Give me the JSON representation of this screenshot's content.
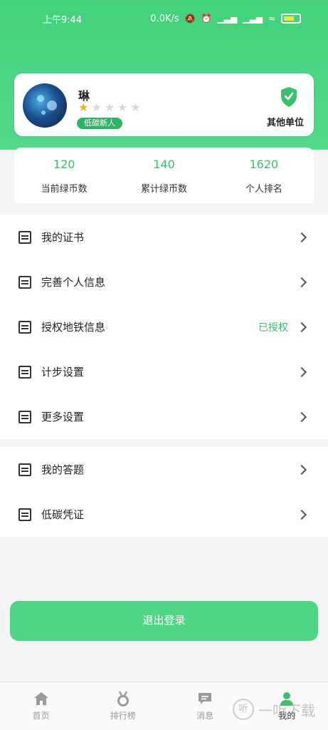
{
  "status_bar": {
    "time": "上午9:44",
    "net_speed": "0.0K/s",
    "icons": [
      "mute-icon",
      "alarm-icon",
      "signal-icon",
      "signal-icon",
      "wifi-icon",
      "battery-icon"
    ]
  },
  "profile": {
    "name": "琳",
    "rating": 1,
    "rating_max": 5,
    "badge": "低碳新人",
    "org_label": "其他单位"
  },
  "stats": [
    {
      "value": "120",
      "label": "当前绿币数"
    },
    {
      "value": "140",
      "label": "累计绿币数"
    },
    {
      "value": "1620",
      "label": "个人排名"
    }
  ],
  "menu_group1": [
    {
      "label": "我的证书",
      "status": ""
    },
    {
      "label": "完善个人信息",
      "status": ""
    },
    {
      "label": "授权地铁信息",
      "status": "已授权"
    },
    {
      "label": "计步设置",
      "status": ""
    },
    {
      "label": "更多设置",
      "status": ""
    }
  ],
  "menu_group2": [
    {
      "label": "我的答题",
      "status": ""
    },
    {
      "label": "低碳凭证",
      "status": ""
    }
  ],
  "logout_label": "退出登录",
  "tabs": [
    {
      "label": "首页",
      "icon": "home-icon"
    },
    {
      "label": "排行榜",
      "icon": "medal-icon"
    },
    {
      "label": "消息",
      "icon": "message-icon"
    },
    {
      "label": "我的",
      "icon": "user-icon"
    }
  ],
  "watermark": {
    "circle": "听",
    "text": "一听下载"
  },
  "colors": {
    "brand_green": "#43d17a",
    "accent_text": "#3bbf6e",
    "star": "#f2b01e"
  }
}
